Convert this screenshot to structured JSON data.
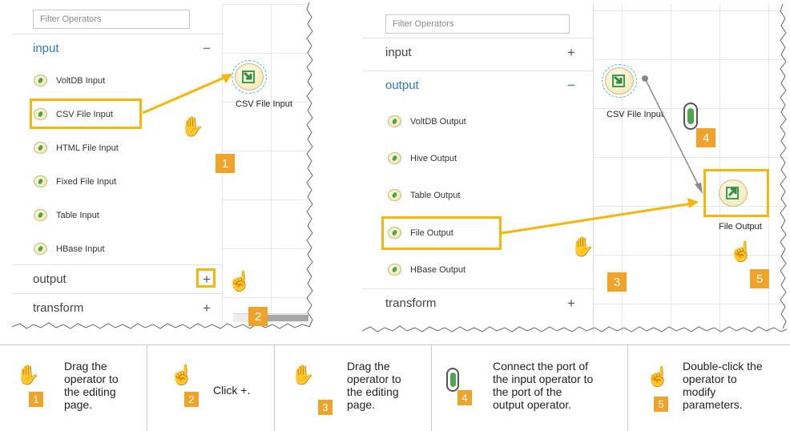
{
  "panel_left": {
    "filter_placeholder": "Filter Operators",
    "groups": [
      {
        "label": "input",
        "sign": "−"
      },
      {
        "label": "output",
        "sign": "+"
      },
      {
        "label": "transform",
        "sign": "+"
      }
    ],
    "items": [
      "VoltDB Input",
      "CSV File Input",
      "HTML File Input",
      "Fixed File Input",
      "Table Input",
      "HBase Input"
    ],
    "node_label": "CSV File Input",
    "steps": [
      "1",
      "2"
    ]
  },
  "panel_right": {
    "filter_placeholder": "Filter Operators",
    "groups": [
      {
        "label": "input",
        "sign": "+"
      },
      {
        "label": "output",
        "sign": "−"
      },
      {
        "label": "transform",
        "sign": "+"
      }
    ],
    "items": [
      "VoltDB Output",
      "Hive Output",
      "Table Output",
      "File Output",
      "HBase Output"
    ],
    "node_labels": [
      "CSV File Input",
      "File Output"
    ],
    "steps": [
      "3",
      "4",
      "5"
    ]
  },
  "legend": [
    {
      "num": "1",
      "text": "Drag the\noperator to\nthe editing\npage."
    },
    {
      "num": "2",
      "text": "Click +."
    },
    {
      "num": "3",
      "text": "Drag the\noperator to\nthe editing\npage."
    },
    {
      "num": "4",
      "text": "Connect the port of\nthe input operator to\nthe port of the\noutput operator."
    },
    {
      "num": "5",
      "text": "Double-click the\noperator to\nmodify\nparameters."
    }
  ],
  "colors": {
    "accent": "#f6b60a",
    "badge": "#f0a32a",
    "link": "#2b7bbf",
    "port": "#4aa84a"
  },
  "icons": {
    "drag": "grab-hand-icon",
    "click": "pointer-hand-icon",
    "operator": "operator-icon",
    "port": "port-icon"
  }
}
